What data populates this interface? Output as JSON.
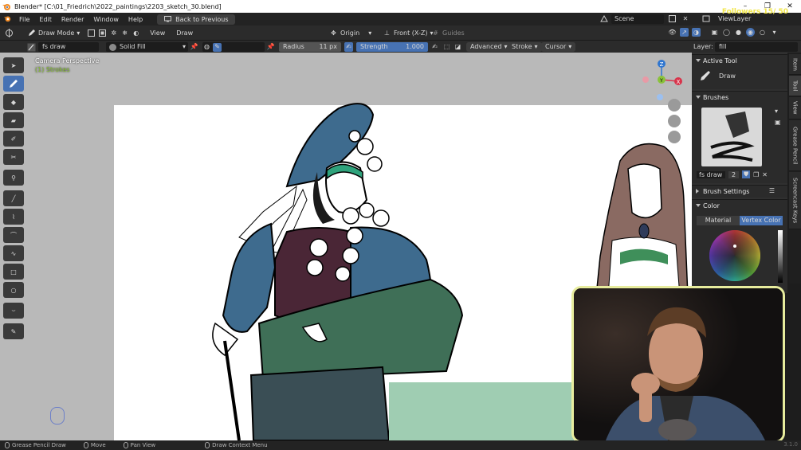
{
  "window": {
    "title": "Blender* [C:\\01_Friedrich\\2022_paintings\\2203_sketch_30.blend]",
    "controls": [
      "–",
      "❐",
      "✕"
    ]
  },
  "menu": {
    "items": [
      "File",
      "Edit",
      "Render",
      "Window",
      "Help"
    ],
    "back_label": "Back to Previous",
    "scene_label": "Scene",
    "viewlayer_label": "ViewLayer"
  },
  "overlay": {
    "followers": "Followers 15/ 50"
  },
  "header": {
    "mode": "Draw Mode",
    "view": "View",
    "draw": "Draw",
    "origin": "Origin",
    "projection": "Front (X-Z)",
    "guides": "Guides"
  },
  "brushbar": {
    "brush_name": "fs draw",
    "material": "Solid Fill",
    "radius_label": "Radius",
    "radius_value": "11 px",
    "strength_label": "Strength",
    "strength_value": "1.000",
    "advanced": "Advanced",
    "stroke": "Stroke",
    "cursor": "Cursor",
    "layer_label": "Layer:",
    "layer_value": "fill"
  },
  "viewport": {
    "perspective": "Camera Perspective",
    "object": "(1) Strokes",
    "axes": [
      "Z",
      "Y",
      "X"
    ]
  },
  "panel": {
    "active_tool_title": "Active Tool",
    "active_tool": "Draw",
    "brushes_title": "Brushes",
    "brush_name": "fs draw",
    "brush_users": "2",
    "brush_settings_title": "Brush Settings",
    "color_title": "Color",
    "color_tabs": [
      "Material",
      "Vertex Color"
    ]
  },
  "tabs": [
    "Item",
    "Tool",
    "View",
    "Grease Pencil",
    "Screencast Keys"
  ],
  "status": {
    "items": [
      "Grease Pencil Draw",
      "Move",
      "Pan View",
      "Draw Context Menu"
    ],
    "version": "3.1.0"
  },
  "colors": {
    "accent": "#4772b3",
    "coat": "#3e6b8e",
    "skirt": "#3f6f57",
    "bodice": "#4a2636",
    "teal_band": "#2fa37c",
    "webcam_border": "#e7ec9d",
    "overlay_rect": "#9fcdb2",
    "followers": "#f1e64a"
  }
}
